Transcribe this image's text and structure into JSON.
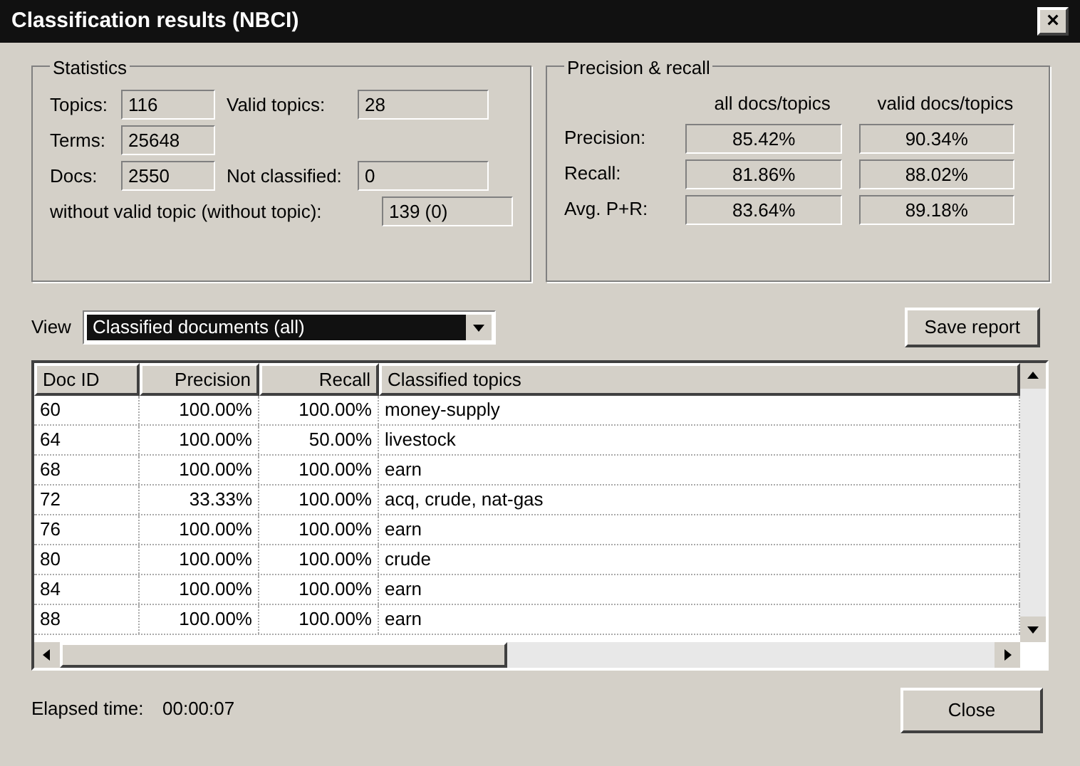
{
  "window": {
    "title": "Classification results (NBCI)",
    "close": "×"
  },
  "statistics": {
    "title": "Statistics",
    "rows": [
      [
        {
          "label": "Topics:",
          "value": "116"
        },
        {
          "label": "Valid topics:",
          "value": "28"
        }
      ],
      [
        {
          "label": "Terms:",
          "value": "25648"
        }
      ],
      [
        {
          "label": "Docs:",
          "value": "2550"
        },
        {
          "label": "Not classified:",
          "value": "0"
        }
      ],
      [
        {
          "label": "without valid topic (without topic):",
          "value": "139 (0)"
        }
      ]
    ]
  },
  "precision_recall": {
    "title": "Precision & recall",
    "columns": [
      "all docs/topics",
      "valid docs/topics"
    ],
    "rows": [
      {
        "label": "Precision:",
        "values": [
          "85.42%",
          "90.34%"
        ]
      },
      {
        "label": "Recall:",
        "values": [
          "81.86%",
          "88.02%"
        ]
      },
      {
        "label": "Avg. P+R:",
        "values": [
          "83.64%",
          "89.18%"
        ]
      }
    ]
  },
  "view": {
    "label": "View",
    "value": "Classified documents (all)"
  },
  "save_button": "Save report",
  "table": {
    "columns": [
      "Doc ID",
      "Precision",
      "Recall",
      "Classified topics"
    ],
    "rows": [
      [
        "60",
        "100.00%",
        "100.00%",
        "money-supply"
      ],
      [
        "64",
        "100.00%",
        "50.00%",
        "livestock"
      ],
      [
        "68",
        "100.00%",
        "100.00%",
        "earn"
      ],
      [
        "72",
        "33.33%",
        "100.00%",
        "acq, crude, nat-gas"
      ],
      [
        "76",
        "100.00%",
        "100.00%",
        "earn"
      ],
      [
        "80",
        "100.00%",
        "100.00%",
        "crude"
      ],
      [
        "84",
        "100.00%",
        "100.00%",
        "earn"
      ],
      [
        "88",
        "100.00%",
        "100.00%",
        "earn"
      ]
    ]
  },
  "status": {
    "label": "Elapsed time:",
    "value": "00:00:07"
  },
  "close_button": "Close"
}
